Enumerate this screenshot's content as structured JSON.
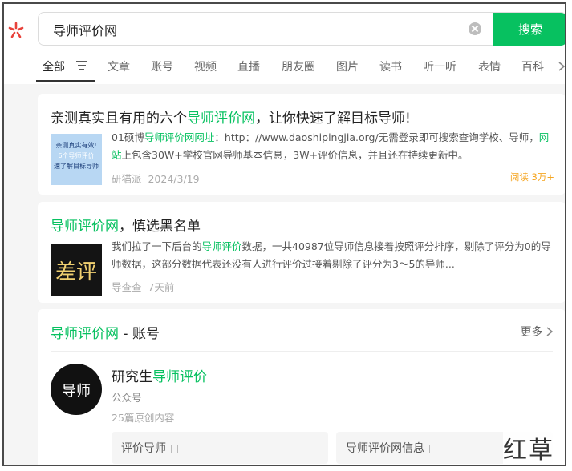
{
  "search": {
    "query": "导师评价网",
    "button_label": "搜索"
  },
  "tabs": [
    {
      "label": "全部",
      "active": true
    },
    {
      "label": "文章"
    },
    {
      "label": "账号"
    },
    {
      "label": "视频"
    },
    {
      "label": "直播"
    },
    {
      "label": "朋友圈"
    },
    {
      "label": "图片"
    },
    {
      "label": "读书"
    },
    {
      "label": "听一听"
    },
    {
      "label": "表情"
    },
    {
      "label": "百科"
    }
  ],
  "results": [
    {
      "title_pre": "亲测真实且有用的六个",
      "title_hl": "导师评价网",
      "title_post": "，让你快速了解目标导师!",
      "thumb_lines": [
        "亲测真实有效!",
        "6个导师评价",
        "速了解目标导师"
      ],
      "desc_parts": [
        {
          "t": "01硕博"
        },
        {
          "t": "导师评价网网址",
          "hl": true
        },
        {
          "t": "：http：//www.daoshipingjia.org/无需登录即可搜索查询学校、导师，"
        },
        {
          "t": "网站",
          "hl": true
        },
        {
          "t": "上包含30W+学校官网导师基本信息，3W+评价信息，并且还在持续更新中。"
        }
      ],
      "source": "研猫派",
      "date": "2024/3/19",
      "reads": "阅读 3万+"
    },
    {
      "title_hl": "导师评价网",
      "title_post": "，慎选黑名单",
      "thumb_text": "差评",
      "desc_parts": [
        {
          "t": "我们拉了一下后台的"
        },
        {
          "t": "导师评价",
          "hl": true
        },
        {
          "t": "数据，一共40987位导师信息接着按照评分排序，剔除了评分为0的导师数据，这部分数据代表还没有人进行评价过接着剔除了评分为3～5的导师..."
        }
      ],
      "source": "导查查",
      "date": "7天前"
    }
  ],
  "account_section": {
    "title_hl": "导师评价网",
    "title_post": " - 账号",
    "more_label": "更多",
    "avatar_text": "导师",
    "name_pre": "研究生",
    "name_hl": "导师评价",
    "type": "公众号",
    "count": "25篇原创内容",
    "chips": [
      "评价导师",
      "导师评价网信息"
    ]
  },
  "watermark": "红草",
  "colors": {
    "accent": "#07c160",
    "reads": "#f5a623"
  }
}
